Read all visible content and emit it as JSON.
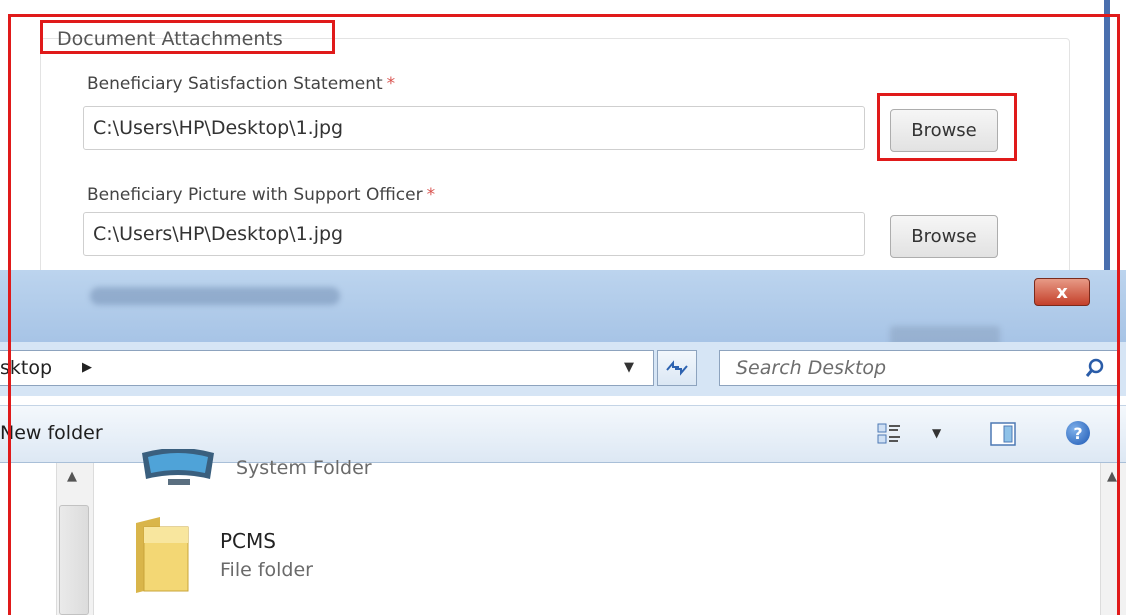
{
  "form": {
    "section_title": "Document Attachments",
    "fields": [
      {
        "label": "Beneficiary Satisfaction Statement",
        "required_mark": "*",
        "value": "C:\\Users\\HP\\Desktop\\1.jpg",
        "button": "Browse"
      },
      {
        "label": "Beneficiary Picture with Support Officer",
        "required_mark": "*",
        "value": "C:\\Users\\HP\\Desktop\\1.jpg",
        "button": "Browse"
      }
    ]
  },
  "dialog": {
    "close_label": "x",
    "address": {
      "breadcrumb": "sktop",
      "breadcrumb_arrow": "▶",
      "dropdown_arrow": "▼",
      "refresh_icon": "refresh-icon"
    },
    "search": {
      "placeholder": "Search Desktop"
    },
    "toolbar": {
      "new_folder": "New folder",
      "views_arrow": "▼",
      "help_label": "?"
    },
    "items": [
      {
        "name": "",
        "type": "System Folder",
        "icon": "computer-icon"
      },
      {
        "name": "PCMS",
        "type": "File folder",
        "icon": "folder-icon"
      }
    ],
    "scroll_arrow": "▲"
  },
  "colors": {
    "annotation": "#e01a1a",
    "titlebar": "#a7c4e6",
    "close": "#c4402a",
    "required": "#d9534f"
  }
}
